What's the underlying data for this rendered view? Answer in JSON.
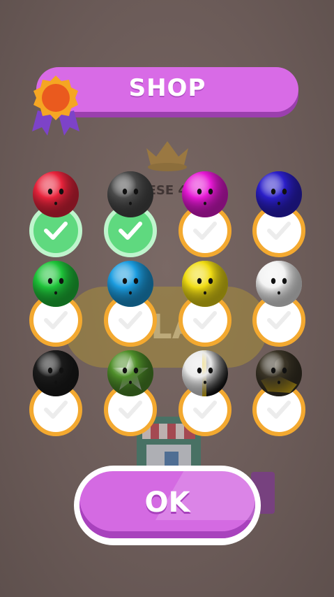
{
  "background": {
    "score_text": "ESE 48",
    "play_label": "LA"
  },
  "shop": {
    "title": "SHOP"
  },
  "balls": [
    {
      "name": "red",
      "color": "#e8243c",
      "owned": true
    },
    {
      "name": "gray",
      "color": "#4a4a4a",
      "owned": true
    },
    {
      "name": "magenta",
      "color": "#e619d4",
      "owned": false
    },
    {
      "name": "blue",
      "color": "#2b1fc9",
      "owned": false
    },
    {
      "name": "green",
      "color": "#1fc43a",
      "owned": false
    },
    {
      "name": "cyan",
      "color": "#1c9de0",
      "owned": false
    },
    {
      "name": "yellow",
      "color": "#f0dc14",
      "owned": false
    },
    {
      "name": "white",
      "color": "#f2f2f2",
      "owned": false
    },
    {
      "name": "black",
      "color": "#1c1c1c",
      "owned": false
    },
    {
      "name": "green-star",
      "color": "#4f8f2a",
      "owned": false
    },
    {
      "name": "white-black-yellow",
      "color": "#eaeaea",
      "owned": false
    },
    {
      "name": "camo-yellow",
      "color": "#3a3426",
      "owned": false
    }
  ],
  "ok_button": {
    "label": "OK"
  }
}
